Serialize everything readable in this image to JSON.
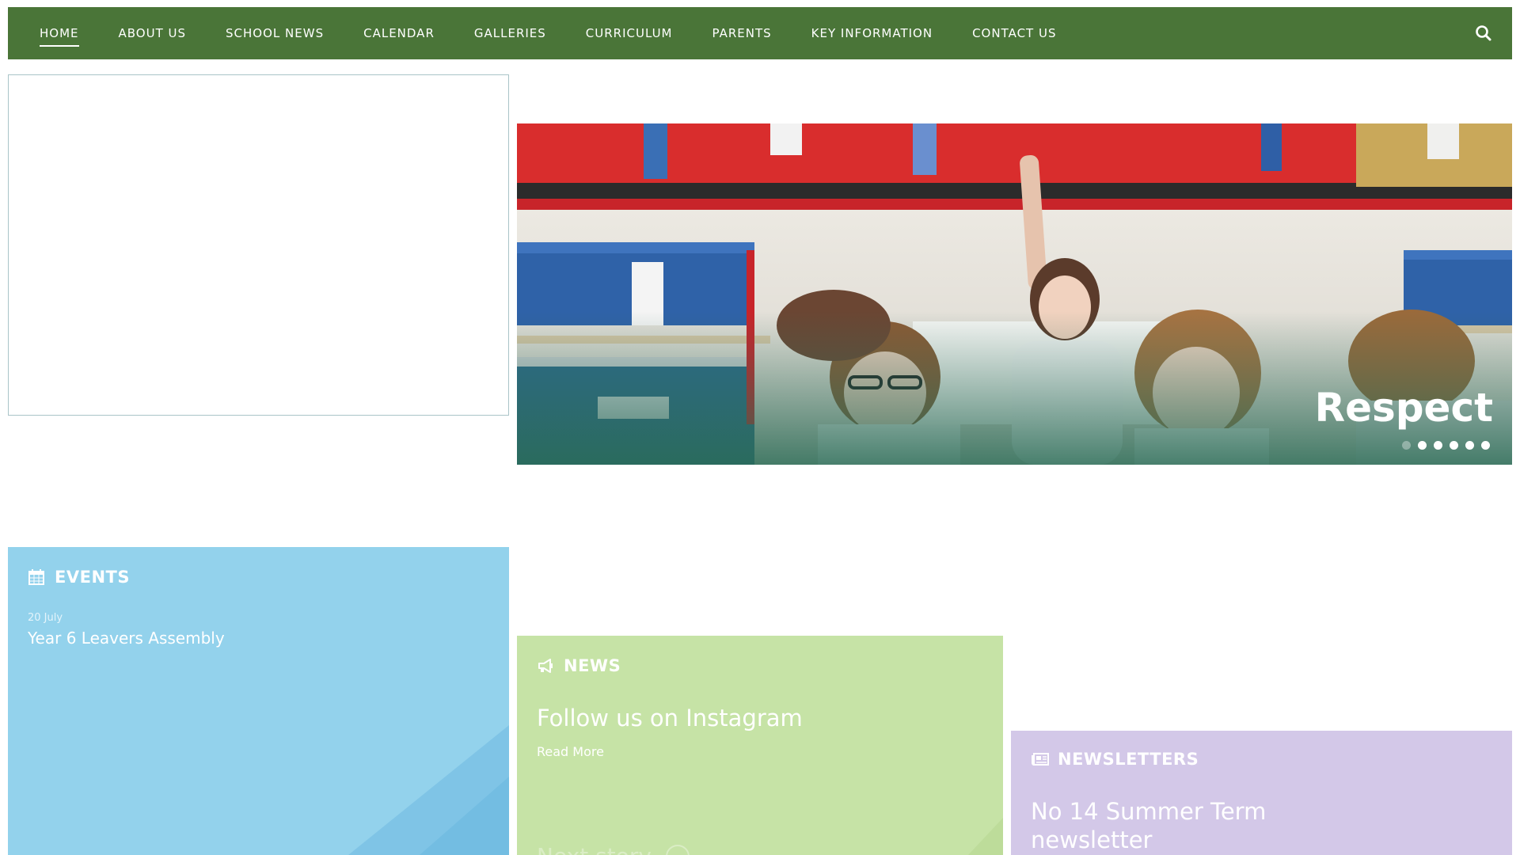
{
  "nav": {
    "items": [
      {
        "label": "HOME",
        "active": true
      },
      {
        "label": "ABOUT US"
      },
      {
        "label": "SCHOOL NEWS"
      },
      {
        "label": "CALENDAR"
      },
      {
        "label": "GALLERIES"
      },
      {
        "label": "CURRICULUM"
      },
      {
        "label": "PARENTS"
      },
      {
        "label": "KEY INFORMATION"
      },
      {
        "label": "CONTACT US"
      }
    ],
    "search_icon": "search-icon",
    "background": "#4a7538"
  },
  "hero": {
    "caption": "Respect",
    "slide_count": 6,
    "active_slide": 1
  },
  "events": {
    "heading": "EVENTS",
    "icon": "calendar-icon",
    "color": "#93d2ec",
    "items": [
      {
        "date": "20 July",
        "title": "Year 6 Leavers Assembly"
      }
    ]
  },
  "news": {
    "heading": "NEWS",
    "icon": "megaphone-icon",
    "color": "#c6e3a6",
    "story_title": "Follow us on Instagram",
    "read_more": "Read More",
    "next_story": "Next story"
  },
  "newsletters": {
    "heading": "NEWSLETTERS",
    "icon": "newspaper-icon",
    "color": "#d3c8e8",
    "title": "No 14 Summer Term newsletter"
  }
}
